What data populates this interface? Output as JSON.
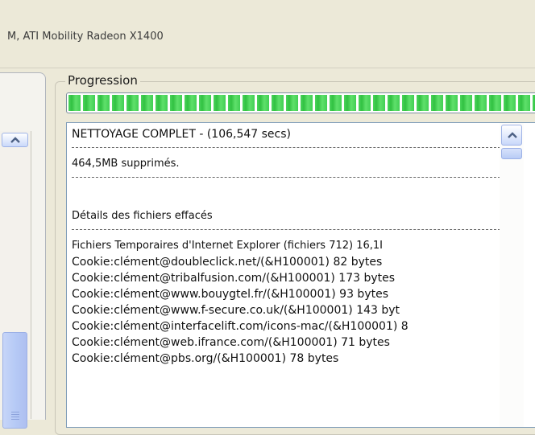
{
  "window": {
    "title_fragment": "M, ATI Mobility Radeon X1400"
  },
  "progress": {
    "group_label": "Progression",
    "fill_fraction": 1.0
  },
  "log": {
    "summary": "NETTOYAGE COMPLET - (106,547 secs)",
    "removed": "464,5MB supprimés.",
    "details_heading": "Détails des fichiers effacés",
    "entries": [
      "Fichiers Temporaires d'Internet Explorer (fichiers 712) 16,1I",
      "Cookie:clément@doubleclick.net/(&H100001) 82 bytes",
      "Cookie:clément@tribalfusion.com/(&H100001) 173 bytes",
      "Cookie:clément@www.bouygtel.fr/(&H100001) 93 bytes",
      "Cookie:clément@www.f-secure.co.uk/(&H100001) 143 byt",
      "Cookie:clément@interfacelift.com/icons-mac/(&H100001) 8",
      "Cookie:clément@web.ifrance.com/(&H100001) 71 bytes",
      "Cookie:clément@pbs.org/(&H100001) 78 bytes"
    ]
  },
  "icons": {
    "left_scroll_up": "chevron-up-icon",
    "log_scroll_up": "chevron-up-icon"
  },
  "colors": {
    "window_bg": "#ece9d8",
    "progress_green": "#31c142",
    "scroll_blue": "#b6caf6"
  }
}
